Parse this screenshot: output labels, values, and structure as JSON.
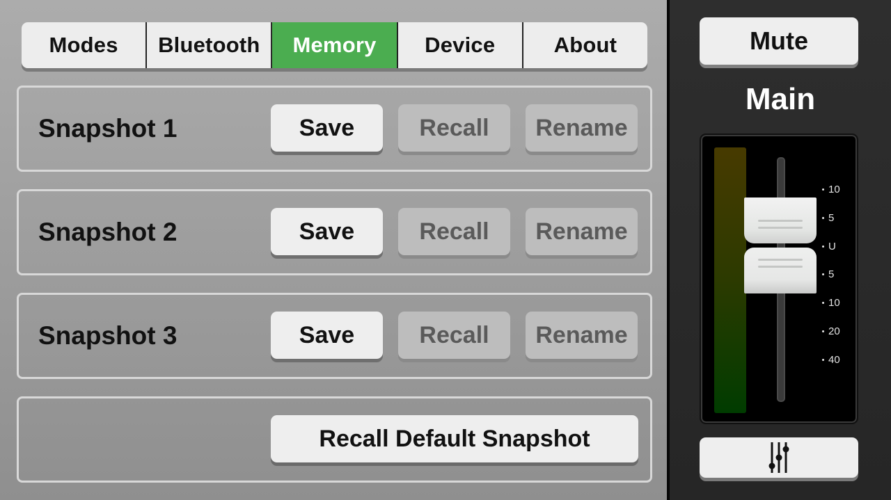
{
  "tabs": [
    {
      "label": "Modes",
      "active": false
    },
    {
      "label": "Bluetooth",
      "active": false
    },
    {
      "label": "Memory",
      "active": true
    },
    {
      "label": "Device",
      "active": false
    },
    {
      "label": "About",
      "active": false
    }
  ],
  "snapshots": [
    {
      "name": "Snapshot 1",
      "save_label": "Save",
      "recall_label": "Recall",
      "rename_label": "Rename",
      "recall_enabled": false,
      "rename_enabled": false
    },
    {
      "name": "Snapshot 2",
      "save_label": "Save",
      "recall_label": "Recall",
      "rename_label": "Rename",
      "recall_enabled": false,
      "rename_enabled": false
    },
    {
      "name": "Snapshot 3",
      "save_label": "Save",
      "recall_label": "Recall",
      "rename_label": "Rename",
      "recall_enabled": false,
      "rename_enabled": false
    }
  ],
  "default_snapshot": {
    "label": "Recall Default Snapshot"
  },
  "channel": {
    "mute_label": "Mute",
    "name": "Main",
    "fader_scale": [
      "10",
      "5",
      "U",
      "5",
      "10",
      "20",
      "40"
    ],
    "eq_icon": "sliders-icon"
  },
  "colors": {
    "active_tab": "#4bad50",
    "meter_top": "#473a00",
    "meter_bottom": "#003c00"
  }
}
